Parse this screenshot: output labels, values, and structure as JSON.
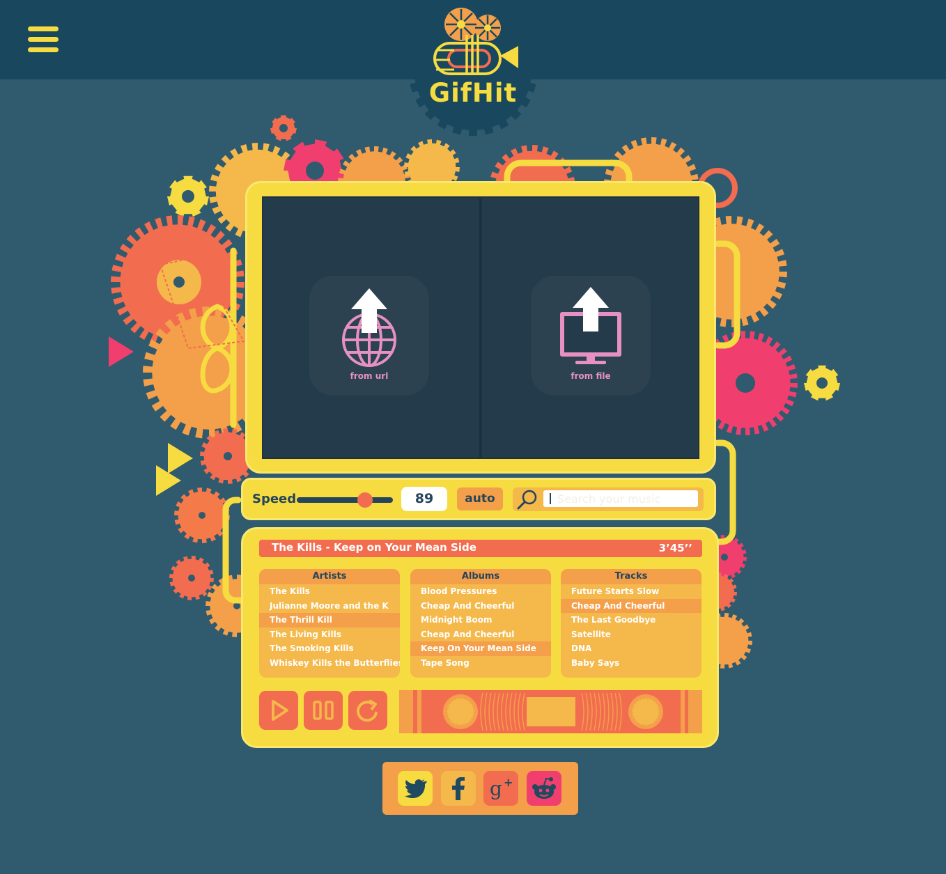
{
  "app": {
    "logo_text": "GifHit"
  },
  "upload": {
    "url_label": "from url",
    "file_label": "from file"
  },
  "controls": {
    "speed_label": "Speed",
    "speed_value": "89",
    "speed_fraction": 0.71,
    "auto_label": "auto",
    "search_placeholder": "Search your music"
  },
  "now_playing": {
    "title": "The Kills - Keep on Your Mean Side",
    "duration": "3’45’’"
  },
  "library": {
    "artists": {
      "header": "Artists",
      "items": [
        "The Kills",
        "Julianne Moore and the K",
        "The Thrill Kill",
        "The Living Kills",
        "The Smoking Kills",
        "Whiskey Kills the Butterflies"
      ],
      "selected_index": 2
    },
    "albums": {
      "header": "Albums",
      "items": [
        "Blood Pressures",
        "Cheap And Cheerful",
        "Midnight Boom",
        "Cheap And Cheerful",
        "Keep On Your Mean Side",
        "Tape Song"
      ],
      "selected_index": 4
    },
    "tracks": {
      "header": "Tracks",
      "items": [
        "Future Starts Slow",
        "Cheap And Cheerful",
        "The Last Goodbye",
        "Satellite",
        "DNA",
        "Baby Says"
      ],
      "selected_index": 1
    }
  },
  "player_buttons": [
    "play-icon",
    "pause-icon",
    "repeat-icon"
  ],
  "social": [
    "twitter-icon",
    "facebook-icon",
    "google-plus-icon",
    "reddit-icon"
  ],
  "colors": {
    "background": "#305a6e",
    "header": "#18475e",
    "yellow": "#f6dc41",
    "orange": "#f49f4a",
    "light_orange": "#f4b84b",
    "red_orange": "#f26c4f",
    "pink": "#f03f6e",
    "screen": "#243b4b"
  }
}
